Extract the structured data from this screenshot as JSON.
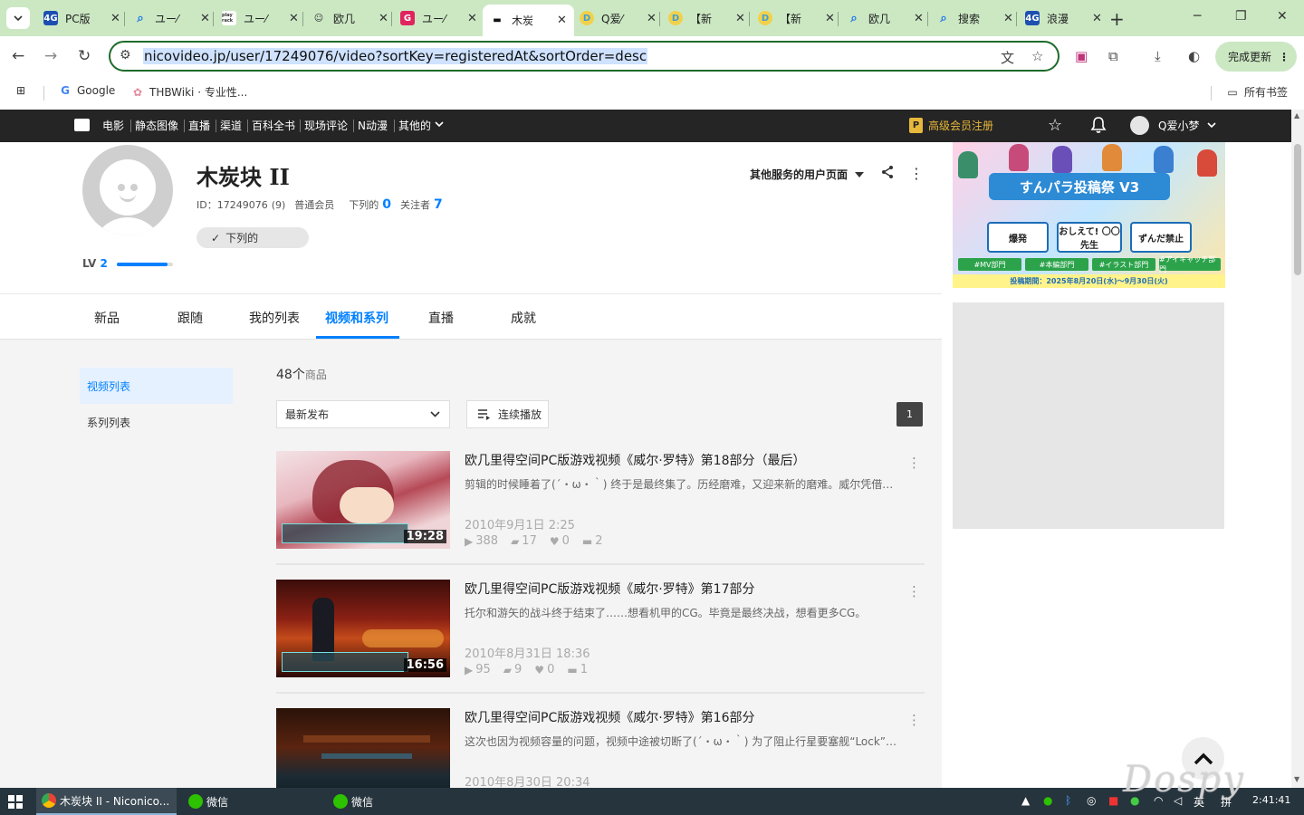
{
  "browser": {
    "tabs": [
      {
        "favicon": "4G",
        "favicon_color": "#1e4fb0",
        "title": "PC版"
      },
      {
        "favicon": "search-icon",
        "favicon_color": "#1a73e8",
        "title": "ユー⁄"
      },
      {
        "favicon": "play rack",
        "favicon_color": "#ffffff",
        "title": "ユー⁄"
      },
      {
        "favicon": "cat-icon",
        "favicon_color": "#333333",
        "title": "欧几"
      },
      {
        "favicon": "G",
        "favicon_color": "#e0245e",
        "title": "ユー⁄"
      },
      {
        "favicon": "niconico-icon",
        "favicon_color": "#111111",
        "title": "木炭"
      },
      {
        "favicon": "D",
        "favicon_color": "#3fa0d8",
        "title": "Q爱⁄"
      },
      {
        "favicon": "D",
        "favicon_color": "#3fa0d8",
        "title": "【新"
      },
      {
        "favicon": "D",
        "favicon_color": "#3fa0d8",
        "title": "【新"
      },
      {
        "favicon": "search-icon",
        "favicon_color": "#1a73e8",
        "title": "欧几"
      },
      {
        "favicon": "search-icon",
        "favicon_color": "#1a73e8",
        "title": "搜索"
      },
      {
        "favicon": "4G",
        "favicon_color": "#1e4fb0",
        "title": "浪漫"
      }
    ],
    "active_tab": 5,
    "url": "nicovideo.jp/user/17249076/video?sortKey=registeredAt&sortOrder=desc",
    "update_label": "完成更新",
    "bookmarks": [
      {
        "icon": "G",
        "label": "Google"
      },
      {
        "icon": "thbwiki-icon",
        "label": "THBWiki · 专业性..."
      }
    ],
    "all_bookmarks_label": "所有书签"
  },
  "sitenav": {
    "items": [
      "电影",
      "静态图像",
      "直播",
      "渠道",
      "百科全书",
      "现场评论",
      "N动漫",
      "其他的"
    ],
    "premium_badge": "P",
    "premium_label": "高级会员注册",
    "username": "Q爱小梦"
  },
  "profile": {
    "name": "木炭块 II",
    "id_text": "ID：17249076",
    "id_extra": "(9)",
    "member_type": "普通会员",
    "following_label": "下列的",
    "following_count": "0",
    "followers_label": "关注者",
    "followers_count": "7",
    "follow_button": "下列的",
    "level_label": "LV",
    "level": "2",
    "level_progress": 0.9,
    "other_services": "其他服务的用户页面"
  },
  "banner": {
    "title": "すんパラ投稿祭 V3",
    "cards": [
      "爆発",
      "おしえて! 〇〇先生",
      "ずんだ禁止"
    ],
    "chips": [
      "#MV部門",
      "#本編部門",
      "#イラスト部門",
      "#アイキャッチ部門"
    ],
    "footer": "投稿期間：2025年8月20日(水)～9月30日(火)"
  },
  "tabs": [
    {
      "label": "新品",
      "active": false
    },
    {
      "label": "跟随",
      "active": false
    },
    {
      "label": "我的列表",
      "active": false
    },
    {
      "label": "视频和系列",
      "active": true
    },
    {
      "label": "直播",
      "active": false
    },
    {
      "label": "成就",
      "active": false
    }
  ],
  "sidebar": [
    {
      "label": "视频列表",
      "active": true
    },
    {
      "label": "系列列表",
      "active": false
    }
  ],
  "list": {
    "count": "48",
    "count_unit": "个",
    "count_suffix": "商品",
    "sort_label": "最新发布",
    "continuous_play": "连续播放",
    "page": "1"
  },
  "videos": [
    {
      "title": "欧几里得空间PC版游戏视频《威尔·罗特》第18部分（最后）",
      "desc": "剪辑的时候睡着了(´・ω・｀) 终于是最终集了。历经磨难，又迎来新的磨难。威尔凭借…",
      "date": "2010年9月1日 2:25",
      "duration": "19:28",
      "views": "388",
      "comments": "17",
      "likes": "0",
      "mylists": "2"
    },
    {
      "title": "欧几里得空间PC版游戏视频《威尔·罗特》第17部分",
      "desc": "托尔和游矢的战斗终于结束了……想看机甲的CG。毕竟是最终决战，想看更多CG。",
      "date": "2010年8月31日 18:36",
      "duration": "16:56",
      "views": "95",
      "comments": "9",
      "likes": "0",
      "mylists": "1"
    },
    {
      "title": "欧几里得空间PC版游戏视频《威尔·罗特》第16部分",
      "desc": "这次也因为视频容量的问题，视频中途被切断了(´・ω・｀) 为了阻止行星要塞舰“Lock”…",
      "date": "2010年8月30日 20:34",
      "duration": "",
      "views": "",
      "comments": "",
      "likes": "",
      "mylists": ""
    }
  ],
  "taskbar": {
    "items": [
      {
        "label": "木炭块 II - Niconico...",
        "active": true
      },
      {
        "label": "微信",
        "active": false
      },
      {
        "label": "微信",
        "active": false
      }
    ],
    "ime_lang": "英",
    "ime_mode": "拼",
    "clock": "2:41:41"
  },
  "watermark": "Dospy",
  "colors": {
    "accent": "#0080ff",
    "sitenav_bg": "#252525",
    "premium": "#e8b83a",
    "browser_frame": "#cbe8c3"
  }
}
